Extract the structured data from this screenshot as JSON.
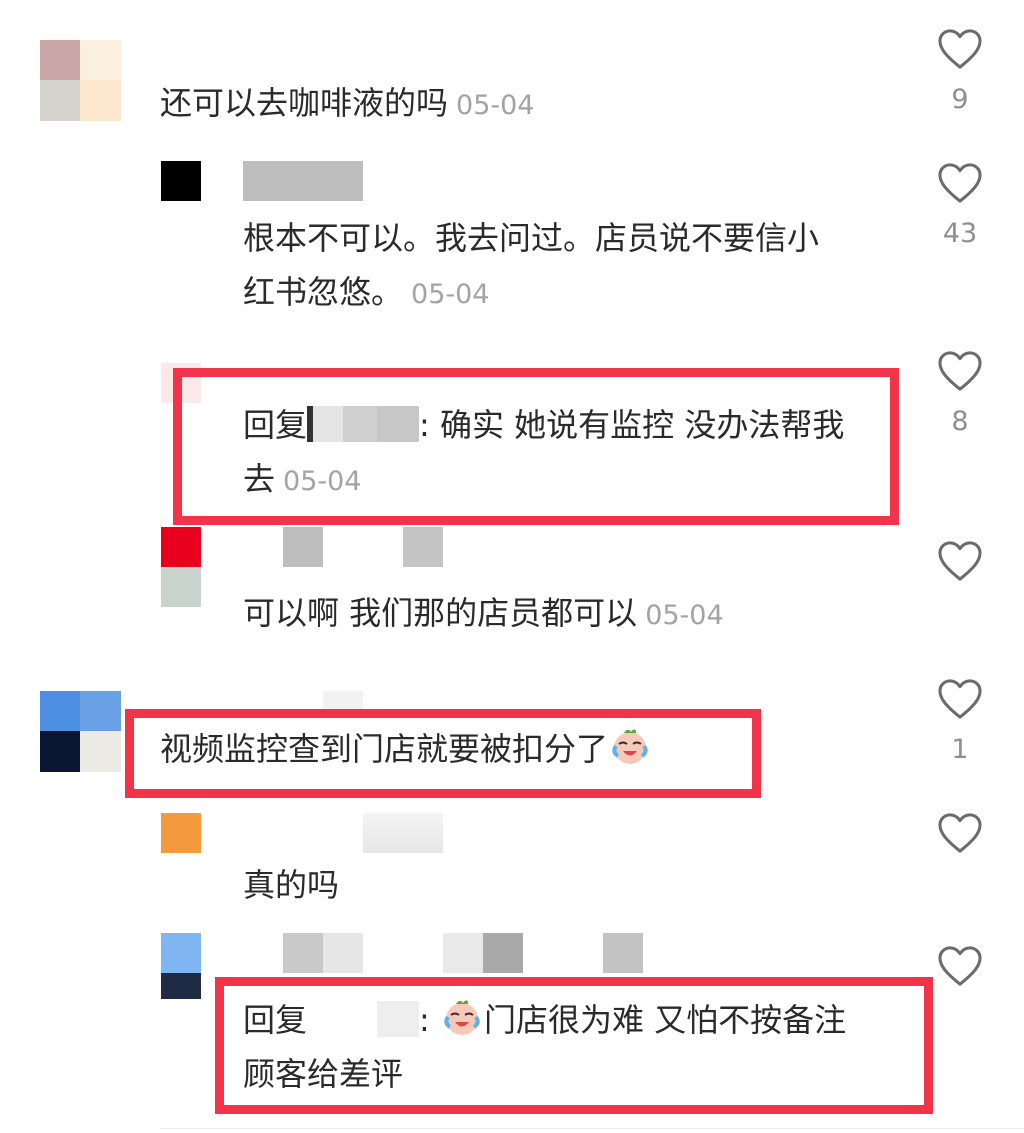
{
  "colors": {
    "highlight": "#f2344a",
    "heart": "#6b6b6b",
    "text": "#2a2a2a",
    "date": "#a3a3a3"
  },
  "comments": [
    {
      "text": "还可以去咖啡液的吗",
      "date": "05-04",
      "likes": "9"
    },
    {
      "text_line1": "根本不可以。我去问过。店员说不要信小",
      "text_line2": "红书忽悠。",
      "date": "05-04",
      "likes": "43"
    },
    {
      "prefix": "回复",
      "text_line1": ": 确实 她说有监控 没办法帮我",
      "text_line2": "去",
      "date": "05-04",
      "likes": "8"
    },
    {
      "text": "可以啊 我们那的店员都可以",
      "date": "05-04"
    },
    {
      "text": "视频监控查到门店就要被扣分了",
      "emoji": "crying-face-emoji",
      "likes": "1"
    },
    {
      "text": "真的吗"
    },
    {
      "prefix": "回复",
      "text_line1": ": ",
      "text_line1b": "门店很为难 又怕不按备注",
      "text_line2": "顾客给差评",
      "emoji": "crying-face-emoji"
    }
  ],
  "icons": {
    "like": "heart-outline-icon",
    "avatar": "pixelated-avatar"
  }
}
